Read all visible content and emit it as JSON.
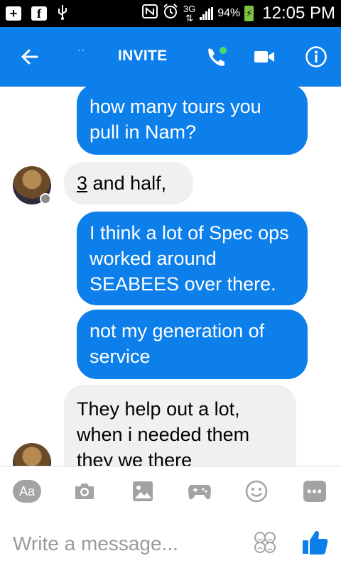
{
  "status_bar": {
    "network_type": "3G",
    "battery_percent": "94%",
    "time": "12:05 PM",
    "icons": [
      "plus-box-icon",
      "facebook-icon",
      "usb-icon",
      "nfc-icon",
      "alarm-icon",
      "signal-icon",
      "battery-charging-icon"
    ]
  },
  "header": {
    "dots": "··",
    "invite_label": "INVITE",
    "icons": [
      "back-arrow-icon",
      "phone-call-icon",
      "video-camera-icon",
      "info-icon"
    ],
    "colors": {
      "bar": "#0d7fea",
      "online_dot": "#4cd964"
    }
  },
  "messages": [
    {
      "direction": "sent",
      "text": "how  many tours you pull in Nam?"
    },
    {
      "direction": "received",
      "text_underlined": "3",
      "text_rest": " and half,"
    },
    {
      "direction": "sent",
      "text": "I think a lot of Spec ops worked around SEABEES over there."
    },
    {
      "direction": "sent",
      "text": "not my generation of service"
    },
    {
      "direction": "received",
      "text": "They help out a lot, when i needed them they we there"
    }
  ],
  "toolbar": {
    "aa_label": "Aa",
    "icons": [
      "aa-icon",
      "camera-icon",
      "gallery-icon",
      "game-controller-icon",
      "emoji-icon",
      "more-icon"
    ]
  },
  "composer": {
    "placeholder": "Write a message...",
    "icons": [
      "sticker-emoji-icon",
      "thumbs-up-icon"
    ]
  }
}
